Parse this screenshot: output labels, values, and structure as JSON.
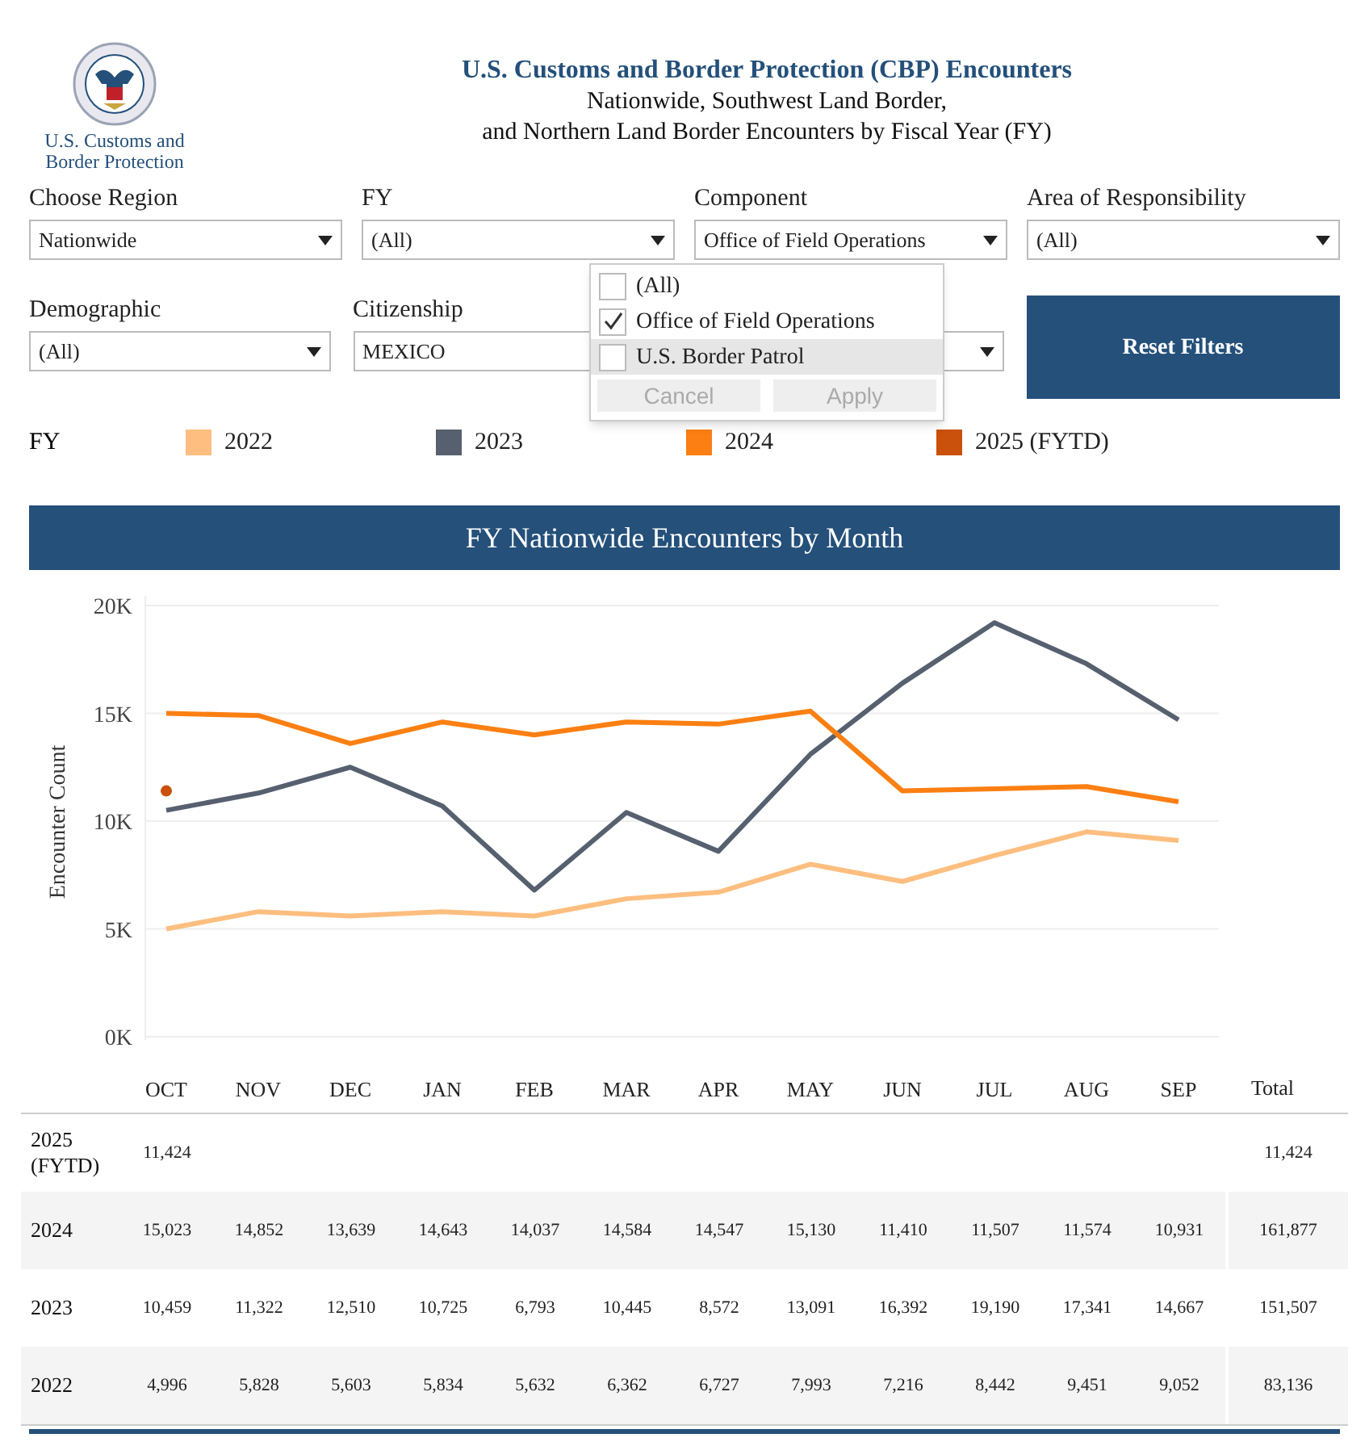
{
  "header": {
    "logo_lines": [
      "U.S. Customs and",
      "Border Protection"
    ],
    "title": "U.S. Customs and Border Protection (CBP) Encounters",
    "subtitle_lines": [
      "Nationwide, Southwest Land Border,",
      "and Northern Land Border Encounters by Fiscal Year (FY)"
    ]
  },
  "filters": [
    {
      "label": "Choose Region",
      "value": "Nationwide"
    },
    {
      "label": "FY",
      "value": "(All)"
    },
    {
      "label": "Component",
      "value": "Office of Field Operations"
    },
    {
      "label": "Area of Responsibility",
      "value": "(All)"
    },
    {
      "label": "Demographic",
      "value": "(All)"
    },
    {
      "label": "Citizenship",
      "value": "MEXICO"
    }
  ],
  "dropdown": {
    "items": [
      {
        "label": "(All)",
        "checked": false,
        "highlighted": false
      },
      {
        "label": "Office of Field Operations",
        "checked": true,
        "highlighted": false
      },
      {
        "label": "U.S. Border Patrol",
        "checked": false,
        "highlighted": true
      }
    ],
    "buttons": [
      {
        "label": "Cancel",
        "disabled": true
      },
      {
        "label": "Apply",
        "disabled": true
      }
    ]
  },
  "reset_button": "Reset Filters",
  "legend_title": "FY",
  "chart": {
    "title": "FY Nationwide Encounters by Month",
    "total_header": "Total",
    "chart_data": {
      "type": "line",
      "ylabel": "Encounter Count",
      "grid": true,
      "categories": [
        "OCT",
        "NOV",
        "DEC",
        "JAN",
        "FEB",
        "MAR",
        "APR",
        "MAY",
        "JUN",
        "JUL",
        "AUG",
        "SEP"
      ],
      "ylim": [
        0,
        20000
      ],
      "yticks": [
        {
          "value": 0,
          "label": "0K"
        },
        {
          "value": 5000,
          "label": "5K"
        },
        {
          "value": 10000,
          "label": "10K"
        },
        {
          "value": 15000,
          "label": "15K"
        },
        {
          "value": 20000,
          "label": "20K"
        }
      ],
      "series": [
        {
          "name": "2022",
          "color": "#fdbe7f",
          "values": [
            5000,
            5800,
            5600,
            5800,
            5600,
            6400,
            6700,
            8000,
            7200,
            8400,
            9500,
            9100
          ]
        },
        {
          "name": "2023",
          "color": "#56606f",
          "values": [
            10500,
            11300,
            12500,
            10700,
            6800,
            10400,
            8600,
            13100,
            16400,
            19200,
            17300,
            14700
          ]
        },
        {
          "name": "2024",
          "color": "#fb7f12",
          "values": [
            15000,
            14900,
            13600,
            14600,
            14000,
            14600,
            14500,
            15100,
            11400,
            11500,
            11600,
            10900
          ]
        },
        {
          "name": "2025 (FYTD)",
          "color": "#c9510c",
          "marker": true,
          "values": [
            11400,
            null,
            null,
            null,
            null,
            null,
            null,
            null,
            null,
            null,
            null,
            null
          ]
        }
      ]
    }
  },
  "table": {
    "rows": [
      {
        "label": "2025 (FYTD)",
        "values": [
          "11,424"
        ],
        "total": "11,424"
      },
      {
        "label": "2024",
        "values": [
          "15,023",
          "14,852",
          "13,639",
          "14,643",
          "14,037",
          "14,584",
          "14,547",
          "15,130",
          "11,410",
          "11,507",
          "11,574",
          "10,931"
        ],
        "total": "161,877"
      },
      {
        "label": "2023",
        "values": [
          "10,459",
          "11,322",
          "12,510",
          "10,725",
          "6,793",
          "10,445",
          "8,572",
          "13,091",
          "16,392",
          "19,190",
          "17,341",
          "14,667"
        ],
        "total": "151,507"
      },
      {
        "label": "2022",
        "values": [
          "4,996",
          "5,828",
          "5,603",
          "5,834",
          "5,632",
          "6,362",
          "6,727",
          "7,993",
          "7,216",
          "8,442",
          "9,451",
          "9,052"
        ],
        "total": "83,136"
      }
    ]
  }
}
